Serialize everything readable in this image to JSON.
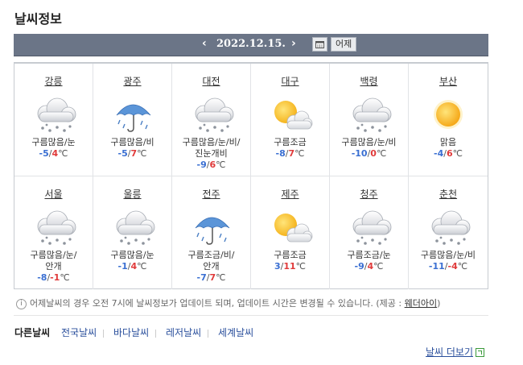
{
  "title": "날씨정보",
  "date_nav": {
    "prev": "‹",
    "date": "2022.12.15.",
    "next": "›",
    "yesterday_label": "어제"
  },
  "temp_unit": "℃",
  "cities": [
    {
      "name": "강릉",
      "desc": "구름많음/눈",
      "low": "-5",
      "high": "4",
      "icon": "cloud-snow"
    },
    {
      "name": "광주",
      "desc": "구름많음/비",
      "low": "-5",
      "high": "7",
      "icon": "umbrella-rain"
    },
    {
      "name": "대전",
      "desc": "구름많음/눈/비/진눈개비",
      "low": "-9",
      "high": "6",
      "icon": "cloud-snow"
    },
    {
      "name": "대구",
      "desc": "구름조금",
      "low": "-8",
      "high": "7",
      "icon": "sun-cloud"
    },
    {
      "name": "백령",
      "desc": "구름많음/눈/비",
      "low": "-10",
      "high": "0",
      "icon": "cloud-snow"
    },
    {
      "name": "부산",
      "desc": "맑음",
      "low": "-4",
      "high": "6",
      "icon": "sun"
    },
    {
      "name": "서울",
      "desc": "구름많음/눈/안개",
      "low": "-8",
      "high": "-1",
      "icon": "cloud-snow"
    },
    {
      "name": "울릉",
      "desc": "구름많음/눈",
      "low": "-1",
      "high": "4",
      "icon": "cloud-snow"
    },
    {
      "name": "전주",
      "desc": "구름조금/비/안개",
      "low": "-7",
      "high": "7",
      "icon": "umbrella-rain"
    },
    {
      "name": "제주",
      "desc": "구름조금",
      "low": "3",
      "high": "11",
      "icon": "sun-cloud"
    },
    {
      "name": "청주",
      "desc": "구름조금/눈",
      "low": "-9",
      "high": "4",
      "icon": "cloud-snow"
    },
    {
      "name": "춘천",
      "desc": "구름많음/눈/비",
      "low": "-11",
      "high": "-4",
      "icon": "cloud-snow"
    }
  ],
  "notice": {
    "text": "어제날씨의 경우 오전 7시에 날씨정보가 업데이트 되며, 업데이트 시간은 변경될 수 있습니다. (제공 : ",
    "provider": "웨더아이",
    "close": ")"
  },
  "other_weather": {
    "label": "다른날씨",
    "links": [
      "전국날씨",
      "바다날씨",
      "레저날씨",
      "세계날씨"
    ]
  },
  "more_link": "날씨 더보기",
  "colors": {
    "low": "#3a6fd2",
    "high": "#e03a3a",
    "header_bar": "#6b7587"
  }
}
